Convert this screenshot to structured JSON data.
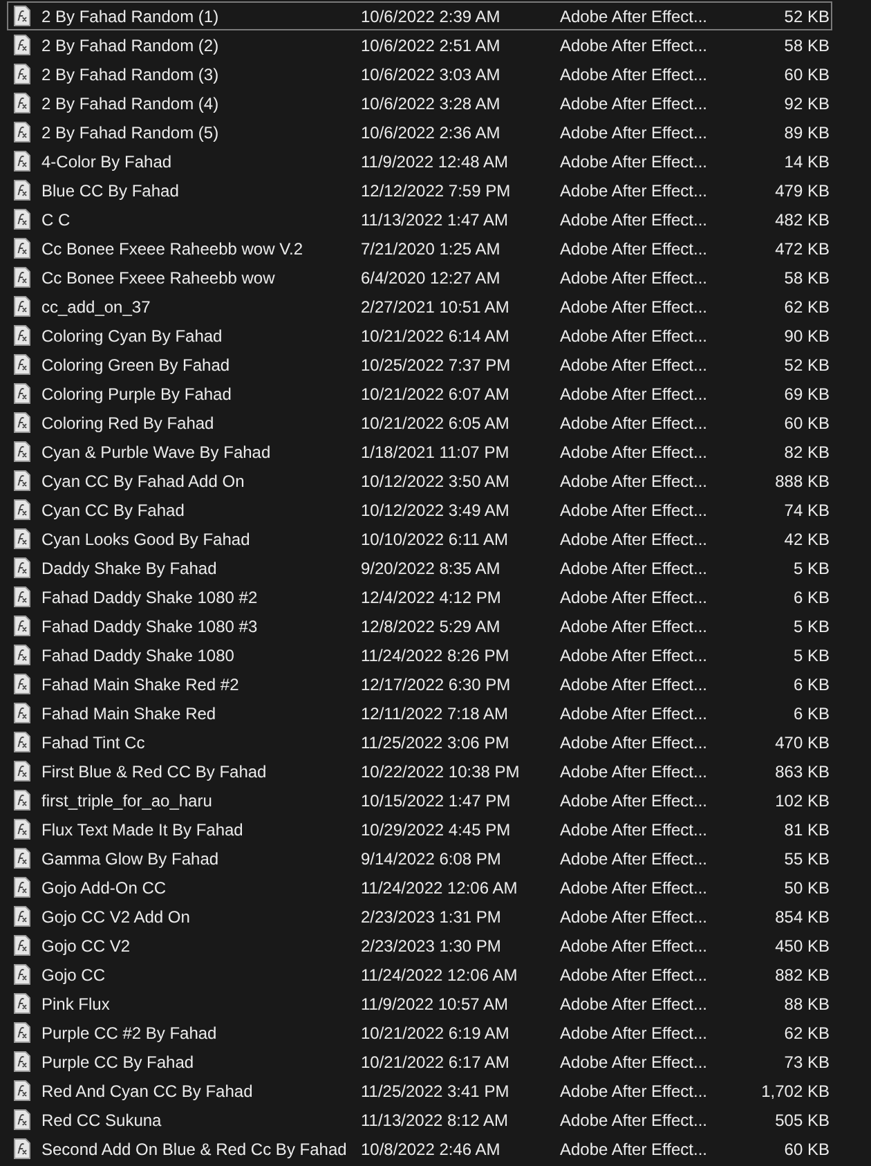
{
  "files": [
    {
      "name": "2 By Fahad Random (1)",
      "date": "10/6/2022 2:39 AM",
      "type": "Adobe After Effect...",
      "size": "52 KB",
      "selected": true
    },
    {
      "name": "2 By Fahad Random (2)",
      "date": "10/6/2022 2:51 AM",
      "type": "Adobe After Effect...",
      "size": "58 KB",
      "selected": false
    },
    {
      "name": "2 By Fahad Random (3)",
      "date": "10/6/2022 3:03 AM",
      "type": "Adobe After Effect...",
      "size": "60 KB",
      "selected": false
    },
    {
      "name": "2 By Fahad Random (4)",
      "date": "10/6/2022 3:28 AM",
      "type": "Adobe After Effect...",
      "size": "92 KB",
      "selected": false
    },
    {
      "name": "2 By Fahad Random (5)",
      "date": "10/6/2022 2:36 AM",
      "type": "Adobe After Effect...",
      "size": "89 KB",
      "selected": false
    },
    {
      "name": "4-Color By Fahad",
      "date": "11/9/2022 12:48 AM",
      "type": "Adobe After Effect...",
      "size": "14 KB",
      "selected": false
    },
    {
      "name": "Blue CC By Fahad",
      "date": "12/12/2022 7:59 PM",
      "type": "Adobe After Effect...",
      "size": "479 KB",
      "selected": false
    },
    {
      "name": "C C",
      "date": "11/13/2022 1:47 AM",
      "type": "Adobe After Effect...",
      "size": "482 KB",
      "selected": false
    },
    {
      "name": "Cc Bonee Fxeee Raheebb wow V.2",
      "date": "7/21/2020 1:25 AM",
      "type": "Adobe After Effect...",
      "size": "472 KB",
      "selected": false
    },
    {
      "name": "Cc Bonee Fxeee Raheebb wow",
      "date": "6/4/2020 12:27 AM",
      "type": "Adobe After Effect...",
      "size": "58 KB",
      "selected": false
    },
    {
      "name": "cc_add_on_37",
      "date": "2/27/2021 10:51 AM",
      "type": "Adobe After Effect...",
      "size": "62 KB",
      "selected": false
    },
    {
      "name": "Coloring Cyan By Fahad",
      "date": "10/21/2022 6:14 AM",
      "type": "Adobe After Effect...",
      "size": "90 KB",
      "selected": false
    },
    {
      "name": "Coloring Green By Fahad",
      "date": "10/25/2022 7:37 PM",
      "type": "Adobe After Effect...",
      "size": "52 KB",
      "selected": false
    },
    {
      "name": "Coloring Purple By Fahad",
      "date": "10/21/2022 6:07 AM",
      "type": "Adobe After Effect...",
      "size": "69 KB",
      "selected": false
    },
    {
      "name": "Coloring Red By Fahad",
      "date": "10/21/2022 6:05 AM",
      "type": "Adobe After Effect...",
      "size": "60 KB",
      "selected": false
    },
    {
      "name": "Cyan & Purble Wave By Fahad",
      "date": "1/18/2021 11:07 PM",
      "type": "Adobe After Effect...",
      "size": "82 KB",
      "selected": false
    },
    {
      "name": "Cyan CC By Fahad Add On",
      "date": "10/12/2022 3:50 AM",
      "type": "Adobe After Effect...",
      "size": "888 KB",
      "selected": false
    },
    {
      "name": "Cyan CC By Fahad",
      "date": "10/12/2022 3:49 AM",
      "type": "Adobe After Effect...",
      "size": "74 KB",
      "selected": false
    },
    {
      "name": "Cyan Looks Good By Fahad",
      "date": "10/10/2022 6:11 AM",
      "type": "Adobe After Effect...",
      "size": "42 KB",
      "selected": false
    },
    {
      "name": "Daddy Shake By Fahad",
      "date": "9/20/2022 8:35 AM",
      "type": "Adobe After Effect...",
      "size": "5 KB",
      "selected": false
    },
    {
      "name": "Fahad Daddy Shake 1080 #2",
      "date": "12/4/2022 4:12 PM",
      "type": "Adobe After Effect...",
      "size": "6 KB",
      "selected": false
    },
    {
      "name": "Fahad Daddy Shake 1080 #3",
      "date": "12/8/2022 5:29 AM",
      "type": "Adobe After Effect...",
      "size": "5 KB",
      "selected": false
    },
    {
      "name": "Fahad Daddy Shake 1080",
      "date": "11/24/2022 8:26 PM",
      "type": "Adobe After Effect...",
      "size": "5 KB",
      "selected": false
    },
    {
      "name": "Fahad Main Shake Red #2",
      "date": "12/17/2022 6:30 PM",
      "type": "Adobe After Effect...",
      "size": "6 KB",
      "selected": false
    },
    {
      "name": "Fahad Main Shake Red",
      "date": "12/11/2022 7:18 AM",
      "type": "Adobe After Effect...",
      "size": "6 KB",
      "selected": false
    },
    {
      "name": "Fahad Tint Cc",
      "date": "11/25/2022 3:06 PM",
      "type": "Adobe After Effect...",
      "size": "470 KB",
      "selected": false
    },
    {
      "name": "First Blue & Red CC By Fahad",
      "date": "10/22/2022 10:38 PM",
      "type": "Adobe After Effect...",
      "size": "863 KB",
      "selected": false
    },
    {
      "name": "first_triple_for_ao_haru",
      "date": "10/15/2022 1:47 PM",
      "type": "Adobe After Effect...",
      "size": "102 KB",
      "selected": false
    },
    {
      "name": "Flux Text Made It By Fahad",
      "date": "10/29/2022 4:45 PM",
      "type": "Adobe After Effect...",
      "size": "81 KB",
      "selected": false
    },
    {
      "name": "Gamma Glow By Fahad",
      "date": "9/14/2022 6:08 PM",
      "type": "Adobe After Effect...",
      "size": "55 KB",
      "selected": false
    },
    {
      "name": "Gojo Add-On CC",
      "date": "11/24/2022 12:06 AM",
      "type": "Adobe After Effect...",
      "size": "50 KB",
      "selected": false
    },
    {
      "name": "Gojo CC V2 Add On",
      "date": "2/23/2023 1:31 PM",
      "type": "Adobe After Effect...",
      "size": "854 KB",
      "selected": false
    },
    {
      "name": "Gojo CC V2",
      "date": "2/23/2023 1:30 PM",
      "type": "Adobe After Effect...",
      "size": "450 KB",
      "selected": false
    },
    {
      "name": "Gojo CC",
      "date": "11/24/2022 12:06 AM",
      "type": "Adobe After Effect...",
      "size": "882 KB",
      "selected": false
    },
    {
      "name": "Pink Flux",
      "date": "11/9/2022 10:57 AM",
      "type": "Adobe After Effect...",
      "size": "88 KB",
      "selected": false
    },
    {
      "name": "Purple CC #2 By Fahad",
      "date": "10/21/2022 6:19 AM",
      "type": "Adobe After Effect...",
      "size": "62 KB",
      "selected": false
    },
    {
      "name": "Purple CC By Fahad",
      "date": "10/21/2022 6:17 AM",
      "type": "Adobe After Effect...",
      "size": "73 KB",
      "selected": false
    },
    {
      "name": "Red And Cyan CC By Fahad",
      "date": "11/25/2022 3:41 PM",
      "type": "Adobe After Effect...",
      "size": "1,702 KB",
      "selected": false
    },
    {
      "name": "Red CC Sukuna",
      "date": "11/13/2022 8:12 AM",
      "type": "Adobe After Effect...",
      "size": "505 KB",
      "selected": false
    },
    {
      "name": "Second Add On Blue & Red Cc By Fahad",
      "date": "10/8/2022 2:46 AM",
      "type": "Adobe After Effect...",
      "size": "60 KB",
      "selected": false
    }
  ]
}
